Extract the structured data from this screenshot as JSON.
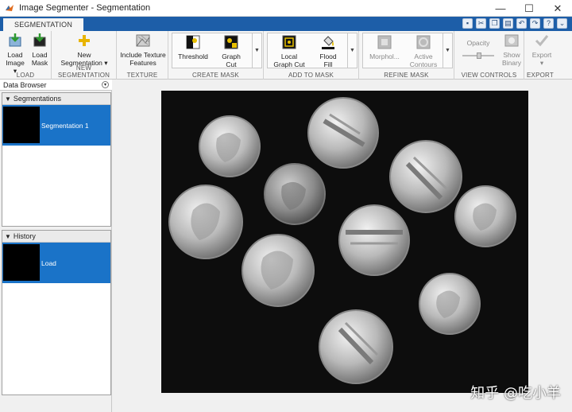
{
  "window": {
    "title": "Image Segmenter - Segmentation",
    "controls": [
      "—",
      "☐",
      "✕"
    ]
  },
  "tabs": {
    "active": "SEGMENTATION"
  },
  "ribbon": {
    "load": {
      "label": "LOAD",
      "buttons": [
        {
          "line1": "Load",
          "line2": "Image ▾",
          "icon": "load-image-icon"
        },
        {
          "line1": "Load",
          "line2": "Mask",
          "icon": "load-mask-icon"
        }
      ]
    },
    "new_segmentation": {
      "label": "NEW SEGMENTATION",
      "button": {
        "line1": "New",
        "line2": "Segmentation ▾",
        "icon": "plus-icon"
      }
    },
    "texture": {
      "label": "TEXTURE",
      "button": {
        "line1": "Include Texture",
        "line2": "Features",
        "icon": "texture-icon"
      }
    },
    "create_mask": {
      "label": "CREATE MASK",
      "buttons": [
        {
          "line1": "Threshold",
          "line2": "",
          "icon": "threshold-icon"
        },
        {
          "line1": "Graph",
          "line2": "Cut",
          "icon": "graph-cut-icon"
        }
      ]
    },
    "add_to_mask": {
      "label": "ADD TO MASK",
      "buttons": [
        {
          "line1": "Local",
          "line2": "Graph Cut",
          "icon": "local-graph-cut-icon"
        },
        {
          "line1": "Flood",
          "line2": "Fill",
          "icon": "flood-fill-icon"
        }
      ]
    },
    "refine_mask": {
      "label": "REFINE MASK",
      "buttons": [
        {
          "line1": "Morphol...",
          "line2": "",
          "icon": "morphology-icon"
        },
        {
          "line1": "Active",
          "line2": "Contours",
          "icon": "active-contours-icon"
        }
      ]
    },
    "view_controls": {
      "label": "VIEW CONTROLS",
      "opacity_label": "Opacity",
      "show_binary": {
        "line1": "Show",
        "line2": "Binary"
      }
    },
    "export": {
      "label": "EXPORT",
      "button": {
        "line1": "Export",
        "line2": "▾"
      }
    }
  },
  "data_browser": {
    "title": "Data Browser",
    "segmentations": {
      "title": "Segmentations",
      "items": [
        "Segmentation 1"
      ]
    },
    "history": {
      "title": "History",
      "items": [
        "Load"
      ]
    }
  },
  "watermark": "知乎 @吃小羊"
}
